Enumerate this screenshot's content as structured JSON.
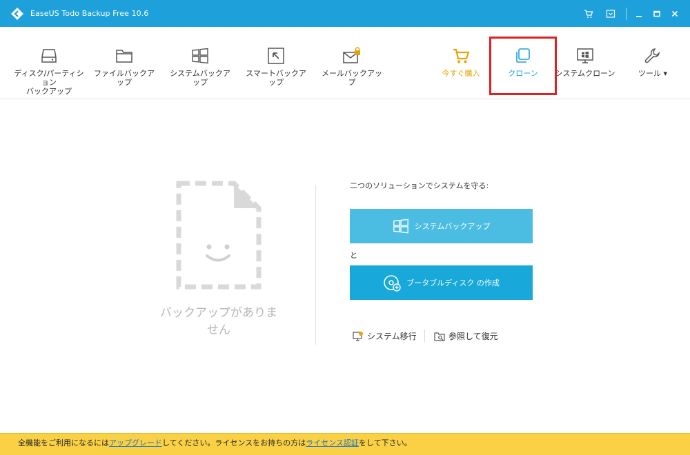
{
  "window": {
    "title": "EaseUS Todo Backup Free 10.6"
  },
  "toolbar": {
    "items": [
      {
        "label": "ディスク/パーティション\nバックアップ",
        "icon": "hard-drive-icon"
      },
      {
        "label": "ファイルバックアップ",
        "icon": "folder-icon"
      },
      {
        "label": "システムバックアップ",
        "icon": "windows-icon"
      },
      {
        "label": "スマートバックアップ",
        "icon": "smart-arrow-icon"
      },
      {
        "label": "メールバックアップ",
        "icon": "mail-lock-icon"
      }
    ],
    "right_items": [
      {
        "label": "今すぐ購入",
        "icon": "cart-icon"
      },
      {
        "label": "クローン",
        "icon": "clone-icon"
      },
      {
        "label": "システムクローン",
        "icon": "system-clone-icon"
      },
      {
        "label": "ツール ▾",
        "icon": "wrench-icon"
      }
    ]
  },
  "main": {
    "empty_text": "バックアップがありません",
    "solution_title": "二つのソリューションでシステムを守る:",
    "system_backup_btn": "システムバックアップ",
    "and_text": "と",
    "portable_disk_btn": "ブータブルディスク の作成",
    "system_migrate": "システム移行",
    "browse_restore": "参照して復元"
  },
  "footer": {
    "text_pre": "全機能をご利用になるには",
    "upgrade_link": "アップグレード",
    "text_mid": "してください。ライセンスをお持ちの方は",
    "license_link": "ライセンス認証",
    "text_post": "をして下さい。"
  },
  "colors": {
    "titlebar": "#1ea1db",
    "accent": "#1ea1db",
    "buy": "#e7a300",
    "highlight": "#e02020",
    "footer": "#fad145"
  }
}
